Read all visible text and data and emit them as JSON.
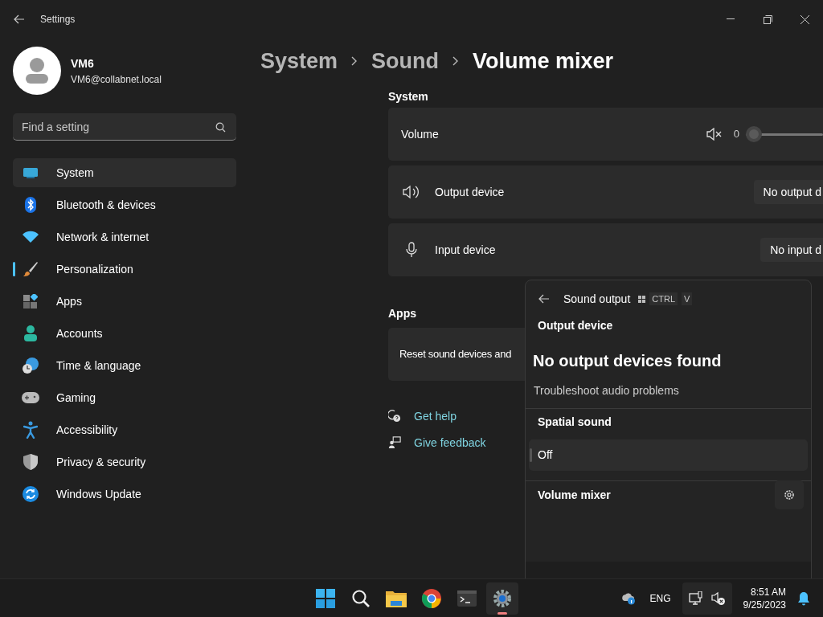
{
  "window": {
    "title": "Settings"
  },
  "user": {
    "name": "VM6",
    "email": "VM6@collabnet.local"
  },
  "search": {
    "placeholder": "Find a setting"
  },
  "nav": [
    {
      "label": "System",
      "selected": true,
      "accent_bar": false
    },
    {
      "label": "Bluetooth & devices",
      "selected": false,
      "accent_bar": false
    },
    {
      "label": "Network & internet",
      "selected": false,
      "accent_bar": false
    },
    {
      "label": "Personalization",
      "selected": false,
      "accent_bar": true
    },
    {
      "label": "Apps",
      "selected": false,
      "accent_bar": false
    },
    {
      "label": "Accounts",
      "selected": false,
      "accent_bar": false
    },
    {
      "label": "Time & language",
      "selected": false,
      "accent_bar": false
    },
    {
      "label": "Gaming",
      "selected": false,
      "accent_bar": false
    },
    {
      "label": "Accessibility",
      "selected": false,
      "accent_bar": false
    },
    {
      "label": "Privacy & security",
      "selected": false,
      "accent_bar": false
    },
    {
      "label": "Windows Update",
      "selected": false,
      "accent_bar": false
    }
  ],
  "breadcrumb": [
    {
      "label": "System",
      "current": false
    },
    {
      "label": "Sound",
      "current": false
    },
    {
      "label": "Volume mixer",
      "current": true
    }
  ],
  "system_section": {
    "heading": "System",
    "volume": {
      "label": "Volume",
      "reading": "0",
      "level": 0
    },
    "rows": [
      {
        "kind": "output",
        "label": "Output device",
        "value": "No output d"
      },
      {
        "kind": "input",
        "label": "Input device",
        "value": "No input d"
      }
    ]
  },
  "apps_section": {
    "heading": "Apps",
    "row": "Reset sound devices and"
  },
  "links": [
    {
      "kind": "help",
      "label": "Get help"
    },
    {
      "kind": "feedback",
      "label": "Give feedback"
    }
  ],
  "flyout": {
    "title": "Sound output",
    "keys": [
      "CTRL",
      "V"
    ],
    "output_heading": "Output device",
    "message": "No output devices found",
    "troubleshoot": "Troubleshoot audio problems",
    "spatial_heading": "Spatial sound",
    "spatial_value": "Off",
    "mixer_heading": "Volume mixer"
  },
  "taskbar": {
    "apps": [
      {
        "kind": "start",
        "active": false
      },
      {
        "kind": "search",
        "active": false
      },
      {
        "kind": "files",
        "active": false
      },
      {
        "kind": "browser",
        "active": false
      },
      {
        "kind": "terminal",
        "active": false
      },
      {
        "kind": "settings",
        "active": true
      }
    ],
    "language": "ENG",
    "time": "8:51 AM",
    "date": "9/25/2023"
  }
}
